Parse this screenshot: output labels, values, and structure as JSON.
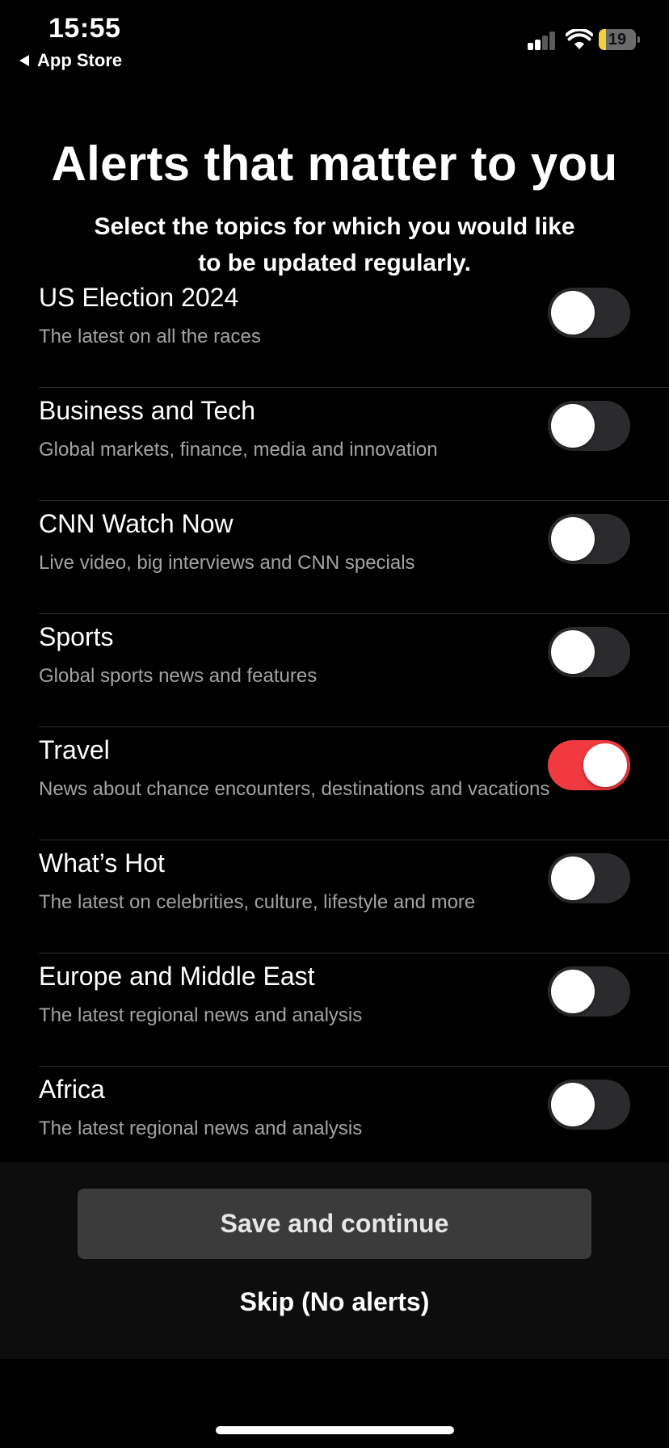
{
  "status_bar": {
    "time": "15:55",
    "back_label": "App Store",
    "battery_level": "19",
    "battery_fraction": 0.19,
    "battery_color": "#f4d03f"
  },
  "header": {
    "title": "Alerts that matter to you",
    "subtitle": "Select the topics for which you would like to be updated regularly."
  },
  "topics": [
    {
      "title": "US Election 2024",
      "description": "The latest on all the races",
      "enabled": false
    },
    {
      "title": "Business and Tech",
      "description": "Global markets, finance, media and innovation",
      "enabled": false
    },
    {
      "title": "CNN Watch Now",
      "description": "Live video, big interviews and CNN specials",
      "enabled": false
    },
    {
      "title": "Sports",
      "description": "Global sports news and features",
      "enabled": false
    },
    {
      "title": "Travel",
      "description": "News about chance encounters, destinations and vacations",
      "enabled": true
    },
    {
      "title": "What’s Hot",
      "description": "The latest on celebrities, culture, lifestyle and more",
      "enabled": false
    },
    {
      "title": "Europe and Middle East",
      "description": "The latest regional news and analysis",
      "enabled": false
    },
    {
      "title": "Africa",
      "description": "The latest regional news and analysis",
      "enabled": false
    }
  ],
  "footer": {
    "save_label": "Save and continue",
    "skip_label": "Skip (No alerts)"
  },
  "colors": {
    "toggle_on": "#f03a3f",
    "toggle_off": "#2b2b2d",
    "background": "#000000"
  },
  "icons": {
    "back": "back-triangle-icon",
    "signal": "cellular-signal-icon",
    "wifi": "wifi-icon",
    "battery": "battery-icon"
  }
}
